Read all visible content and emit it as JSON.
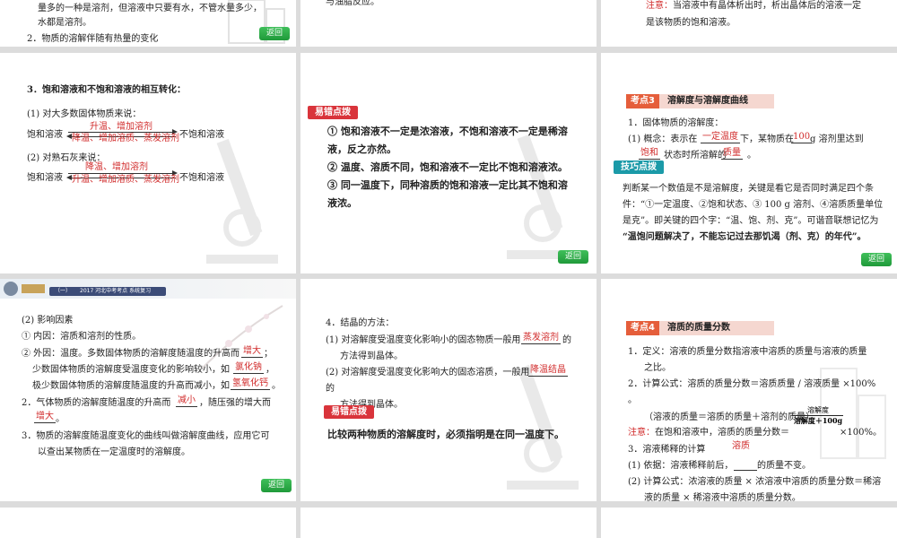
{
  "s1": {
    "line1": "量多的一种是溶剂，但溶液中只要有水，不管水量多少，",
    "line2": "水都是溶剂。",
    "line3": "2．物质的溶解伴随有热量的变化",
    "back": "返回"
  },
  "s2": {
    "line1": "与油脂反应。"
  },
  "s3": {
    "note_prefix": "注意：",
    "note_line1": "当溶液中有晶体析出时，析出晶体后的溶液一定",
    "note_line2": "是该物质的饱和溶液。"
  },
  "s4": {
    "title": "3．饱和溶液和不饱和溶液的相互转化：",
    "sub1": "(1) 对大多数固体物质来说：",
    "sat": "饱和溶液",
    "unsat": "不饱和溶液",
    "a1_top": "升温、增加溶剂",
    "a1_bottom": "降温、增加溶质、蒸发溶剂",
    "sub2": "(2) 对熟石灰来说：",
    "a2_top": "降温、增加溶剂",
    "a2_bottom": "升温、增加溶质、蒸发溶剂"
  },
  "s5": {
    "badge": "易错点拨",
    "p1": "① 饱和溶液不一定是浓溶液，不饱和溶液不一定是稀溶",
    "p1b": "液，反之亦然。",
    "p2": "② 温度、溶质不同，饱和溶液不一定比不饱和溶液浓。",
    "p3": "③ 同一温度下，同种溶质的饱和溶液一定比其不饱和溶",
    "p3b": "液浓。",
    "back": "返回"
  },
  "s6": {
    "kd_label": "考点3",
    "kd_title": "溶解度与溶解度曲线",
    "l1": "1．固体物质的溶解度：",
    "l2_a": "(1) 概念：表示在",
    "l2_ans1": "一定温度",
    "l2_b": "下，某物质在",
    "l2_ans2": "100",
    "l2_c": "g 溶剂里达到",
    "l3_ans1": "饱和",
    "l3_b": "状态时所溶解的",
    "l3_ans2": "质量",
    "l3_c": "。",
    "badge": "技巧点拨",
    "t1": "判断某一个数值是不是溶解度，关键是看它是否同时满足四个条",
    "t2": "件：“①一定温度、②饱和状态、③ 100 g 溶剂、④溶质质量单位",
    "t3": "是克”。即关键的四个字：“温、饱、剂、克”。可谐音联想记忆为",
    "t4": "“温饱问题解决了，不能忘记过去那饥渴（剂、克）的年代”。",
    "back": "返回"
  },
  "s7": {
    "header_text": "2017 河北中考考点 系统复习",
    "header_num": "（一）",
    "l1": "(2) 影响因素",
    "l2": "① 内因：溶质和溶剂的性质。",
    "l3_a": "② 外因：温度。多数固体物质的溶解度随温度的升高而",
    "l3_ans": "增大",
    "l3_b": "；",
    "l4_a": "少数固体物质的溶解度受温度变化的影响较小，如",
    "l4_ans": "氯化钠",
    "l4_b": "，",
    "l5_a": "极少数固体物质的溶解度随温度的升高而减小，如",
    "l5_ans": "氢氧化钙",
    "l5_b": "。",
    "l6_a": "2．气体物质的溶解度随温度的升高而",
    "l6_ans": "减小",
    "l6_b": "，随压强的增大而",
    "l7_ans": "增大",
    "l7_b": "。",
    "l8": "3．物质的溶解度随温度变化的曲线叫做溶解度曲线，应用它可",
    "l9": "以查出某物质在一定温度时的溶解度。",
    "back": "返回"
  },
  "s8": {
    "l1": "4．结晶的方法：",
    "l2_a": "(1) 对溶解度受温度变化影响小的固态物质一般用",
    "l2_ans": "蒸发溶剂",
    "l2_b": "的",
    "l3": "方法得到晶体。",
    "l4_a": "(2) 对溶解度受温度变化影响大的固态溶质，一般用",
    "l4_ans": "降温结晶",
    "l5": "的",
    "l6": "方法得到晶体。",
    "badge": "易错点拨",
    "p1": "比较两种物质的溶解度时，必须指明是在同一温度下。"
  },
  "s9": {
    "kd_label": "考点4",
    "kd_title": "溶质的质量分数",
    "l1": "1．定义：溶液的质量分数指溶液中溶质的质量与溶液的质量",
    "l1b": "之比。",
    "l2": "2．计算公式：溶质的质量分数＝溶质质量 / 溶液质量 ×100%",
    "l2b": "。",
    "l3": "（溶液的质量＝溶质的质量＋溶剂的质量）",
    "frac_num": "溶解度",
    "frac_den": "溶解度＋100g",
    "note_prefix": "注意：",
    "note_text": "在饱和溶液中，溶质的质量分数＝",
    "note_tail": "×100%。",
    "ans_solute": "溶质",
    "l4": "3．溶液稀释的计算",
    "l5_a": "(1) 依据：溶液稀释前后，",
    "l5_b": "的质量不变。",
    "l6": "(2) 计算公式：浓溶液的质量 × 浓溶液中溶质的质量分数＝稀溶",
    "l7": "液的质量 × 稀溶液中溶质的质量分数。"
  }
}
